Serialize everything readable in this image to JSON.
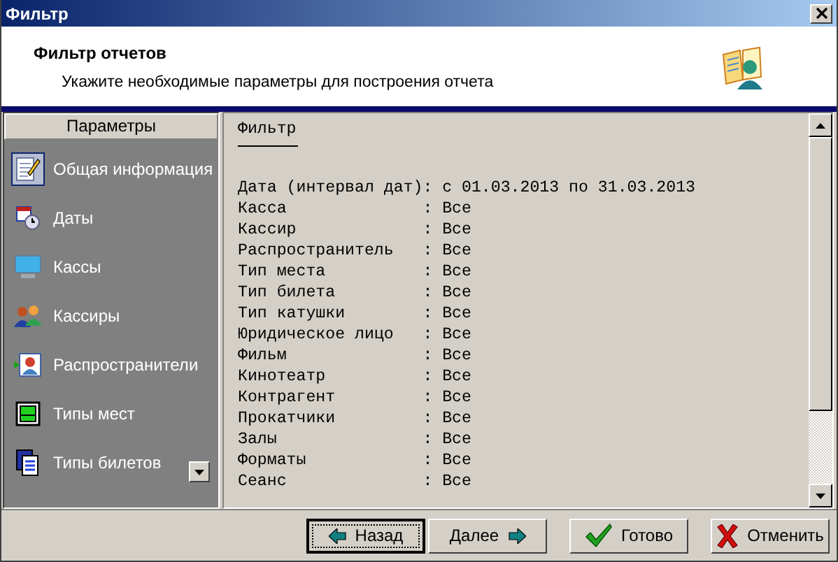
{
  "window": {
    "title": "Фильтр"
  },
  "header": {
    "title": "Фильтр отчетов",
    "subtitle": "Укажите необходимые параметры для построения отчета"
  },
  "sidebar": {
    "title": "Параметры",
    "items": [
      {
        "label": "Общая информация",
        "kind": "notepad",
        "selected": true
      },
      {
        "label": "Даты",
        "kind": "calendar",
        "selected": false
      },
      {
        "label": "Кассы",
        "kind": "monitor",
        "selected": false
      },
      {
        "label": "Кассиры",
        "kind": "people",
        "selected": false
      },
      {
        "label": "Распространители",
        "kind": "person",
        "selected": false
      },
      {
        "label": "Типы мест",
        "kind": "seat",
        "selected": false
      },
      {
        "label": "Типы билетов",
        "kind": "tickets",
        "selected": false
      }
    ]
  },
  "report": {
    "heading": "Фильтр",
    "rows": [
      {
        "label": "Дата (интервал дат)",
        "value": ": с 01.03.2013 по 31.03.2013"
      },
      {
        "label": "Касса",
        "value": ": Все"
      },
      {
        "label": "Кассир",
        "value": ": Все"
      },
      {
        "label": "Распространитель",
        "value": ": Все"
      },
      {
        "label": "Тип места",
        "value": ": Все"
      },
      {
        "label": "Тип билета",
        "value": ": Все"
      },
      {
        "label": "Тип катушки",
        "value": ": Все"
      },
      {
        "label": "Юридическое лицо",
        "value": ": Все"
      },
      {
        "label": "Фильм",
        "value": ": Все"
      },
      {
        "label": "Кинотеатр",
        "value": ": Все"
      },
      {
        "label": "Контрагент",
        "value": ": Все"
      },
      {
        "label": "Прокатчики",
        "value": ": Все"
      },
      {
        "label": "Залы",
        "value": ": Все"
      },
      {
        "label": "Форматы",
        "value": ": Все"
      },
      {
        "label": "Сеанс",
        "value": ": Все"
      }
    ]
  },
  "buttons": [
    {
      "label": "Назад",
      "kind": "back",
      "focused": true
    },
    {
      "label": "Далее",
      "kind": "next",
      "focused": false
    },
    {
      "label": "Готово",
      "kind": "done",
      "focused": false
    },
    {
      "label": "Отменить",
      "kind": "cancel",
      "focused": false
    }
  ]
}
